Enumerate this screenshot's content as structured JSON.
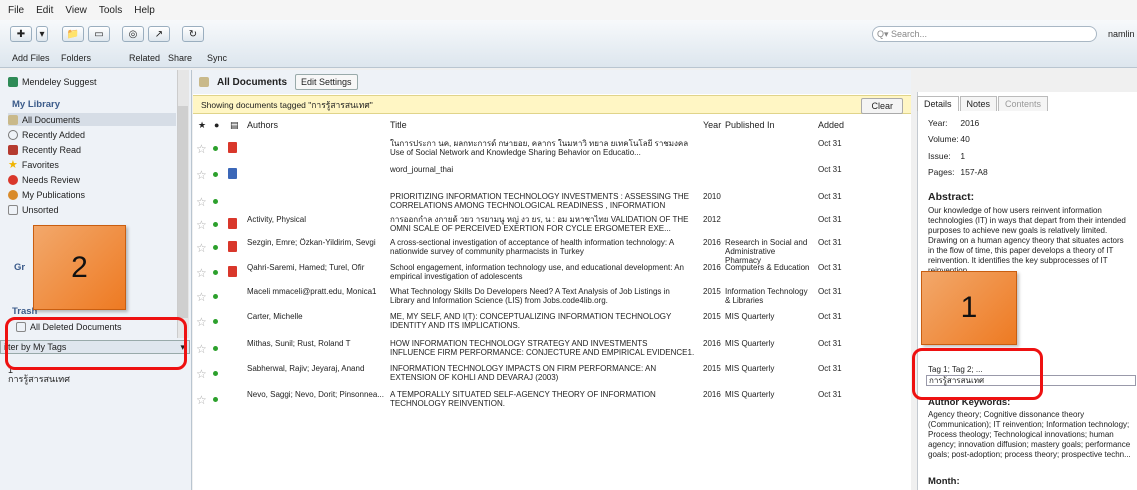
{
  "menu": [
    "File",
    "Edit",
    "View",
    "Tools",
    "Help"
  ],
  "toolbar": {
    "add_files": "Add Files",
    "folders": "Folders",
    "related": "Related",
    "share": "Share",
    "sync": "Sync",
    "search_placeholder": "Q▾ Search...",
    "user": "namlin"
  },
  "sidebar": {
    "mendeley_suggest": "Mendeley Suggest",
    "my_library": "My Library",
    "items": [
      "All Documents",
      "Recently Added",
      "Recently Read",
      "Favorites",
      "Needs Review",
      "My Publications",
      "Unsorted"
    ],
    "groups_partial": "Gr",
    "trash": "Trash",
    "all_deleted": "All Deleted Documents",
    "filter": "ilter by My Tags",
    "count": "1",
    "tag": "การรู้สารสนเทศ"
  },
  "center": {
    "title": "All Documents",
    "edit_settings": "Edit Settings",
    "tag_bar": "Showing documents tagged \"การรู้สารสนเทศ\"",
    "clear": "Clear",
    "columns": {
      "authors": "Authors",
      "title": "Title",
      "year": "Year",
      "published": "Published In",
      "added": "Added"
    },
    "rows": [
      {
        "icon": "pdf",
        "authors": "",
        "title": "ในการประกา นค, ผลกทะการด์ กษายอย, คลากร ในมหาวิ ทยาล ยเทคโนโลยี ราชมงคล Use of Social Network and Knowledge Sharing Behavior on Educatio...",
        "year": "",
        "published": "",
        "added": "Oct 31"
      },
      {
        "icon": "doc",
        "authors": "",
        "title": "word_journal_thai",
        "year": "",
        "published": "",
        "added": "Oct 31"
      },
      {
        "icon": "",
        "authors": "",
        "title": "PRIORITIZING INFORMATION TECHNOLOGY INVESTMENTS : ASSESSING THE CORRELATIONS AMONG TECHNOLOGICAL READINESS , INFORMATION TECH...",
        "year": "2010",
        "published": "",
        "added": "Oct 31"
      },
      {
        "icon": "pdf",
        "authors": "Activity, Physical",
        "title": "การออกกำล งกายด้ วยว ารยามนู หญ่ งว ยร, น : อม มหาชาไทย VALIDATION OF THE OMNI SCALE OF PERCEIVED EXERTION FOR CYCLE ERGOMETER EXE...",
        "year": "2012",
        "published": "",
        "added": "Oct 31"
      },
      {
        "icon": "pdf",
        "authors": "Sezgin, Emre; Özkan-Yildirim, Sevgi",
        "title": "A cross-sectional investigation of acceptance of health information technology: A nationwide survey of community pharmacists in Turkey",
        "year": "2016",
        "published": "Research in Social and Administrative Pharmacy",
        "added": "Oct 31"
      },
      {
        "icon": "pdf",
        "authors": "Qahri-Saremi, Hamed; Turel, Ofir",
        "title": "School engagement, information technology use, and educational development: An empirical investigation of adolescents",
        "year": "2016",
        "published": "Computers & Education",
        "added": "Oct 31"
      },
      {
        "icon": "",
        "authors": "Maceli mmaceli@pratt.edu, Monica1",
        "title": "What Technology Skills Do Developers Need? A Text Analysis of Job Listings in Library and Information Science (LIS) from Jobs.code4lib.org.",
        "year": "2015",
        "published": "Information Technology & Libraries",
        "added": "Oct 31"
      },
      {
        "icon": "",
        "authors": "Carter, Michelle",
        "title": "ME, MY SELF, AND I(T): CONCEPTUALIZING INFORMATION TECHNOLOGY IDENTITY AND ITS IMPLICATIONS.",
        "year": "2015",
        "published": "MIS Quarterly",
        "added": "Oct 31"
      },
      {
        "icon": "",
        "authors": "Mithas, Sunil; Rust, Roland T",
        "title": "HOW INFORMATION TECHNOLOGY STRATEGY AND INVESTMENTS INFLUENCE FIRM PERFORMANCE: CONJECTURE AND EMPIRICAL EVIDENCE1.",
        "year": "2016",
        "published": "MIS Quarterly",
        "added": "Oct 31"
      },
      {
        "icon": "",
        "authors": "Sabherwal, Rajiv; Jeyaraj, Anand",
        "title": "INFORMATION TECHNOLOGY IMPACTS ON FIRM PERFORMANCE: AN EXTENSION OF KOHLI AND DEVARAJ (2003)",
        "year": "2015",
        "published": "MIS Quarterly",
        "added": "Oct 31"
      },
      {
        "icon": "",
        "authors": "Nevo, Saggi; Nevo, Dorit; Pinsonnea...",
        "title": "A TEMPORALLY SITUATED SELF-AGENCY THEORY OF INFORMATION TECHNOLOGY REINVENTION.",
        "year": "2016",
        "published": "MIS Quarterly",
        "added": "Oct 31"
      }
    ]
  },
  "details": {
    "tabs": [
      "Details",
      "Notes",
      "Contents"
    ],
    "year_label": "Year:",
    "year": "2016",
    "volume_label": "Volume:",
    "volume": "40",
    "issue_label": "Issue:",
    "issue": "1",
    "pages_label": "Pages:",
    "pages": "157-A8",
    "abstract_h": "Abstract:",
    "abstract": "Our knowledge of how users reinvent information technologies (IT) in ways that depart from their intended purposes to achieve new goals is relatively limited. Drawing on a human agency theory that situates actors in the flow of time, this paper develops a theory of IT reinvention. It identifies the key subprocesses of IT reinvention...",
    "tags_line": "Tag 1; Tag 2; ...",
    "tag_value": "การรู้สารสนเทศ",
    "kw_h": "Author Keywords:",
    "keywords": "Agency theory; Cognitive dissonance theory (Communication); IT reinvention; Information technology; Process theology; Technological innovations; human agency; innovation diffusion; mastery goals; performance goals; post-adoption; process theory; prospective techn...",
    "month_h": "Month:"
  },
  "annotations": {
    "box1": "1",
    "box2": "2"
  }
}
